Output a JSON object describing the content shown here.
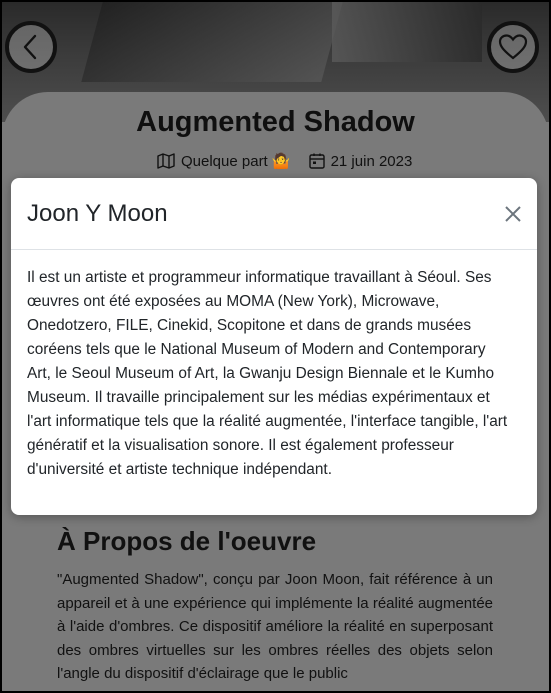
{
  "header": {
    "title": "Augmented Shadow",
    "location": "Quelque part 🤷",
    "date": "21 juin 2023"
  },
  "icons": {
    "back": "chevron-left-icon",
    "favorite": "heart-icon",
    "map": "map-icon",
    "calendar": "calendar-icon",
    "close": "close-icon"
  },
  "modal": {
    "title": "Joon Y Moon",
    "body": "Il est un artiste et programmeur informatique travaillant à Séoul. Ses œuvres ont été exposées au MOMA (New York), Microwave, Onedotzero, FILE, Cinekid, Scopitone et dans de grands musées coréens tels que le National Museum of Modern and Contemporary Art, le Seoul Museum of Art, la Gwanju Design Biennale et le Kumho Museum. Il travaille principalement sur les médias expérimentaux et l'art informatique tels que la réalité augmentée, l'interface tangible, l'art génératif et la visualisation sonore. Il est également professeur d'université et artiste technique indépendant."
  },
  "about": {
    "title": "À Propos de l'oeuvre",
    "text": "\"Augmented Shadow\", conçu par Joon Moon, fait référence à un appareil et à une expérience qui implémente la réalité augmentée à l'aide d'ombres. Ce dispositif améliore la réalité en superposant des ombres virtuelles sur les ombres réelles des objets selon l'angle du dispositif d'éclairage que le public"
  },
  "colors": {
    "backdrop": "#7a7a7a",
    "modal": "#ffffff",
    "text": "#212529"
  }
}
